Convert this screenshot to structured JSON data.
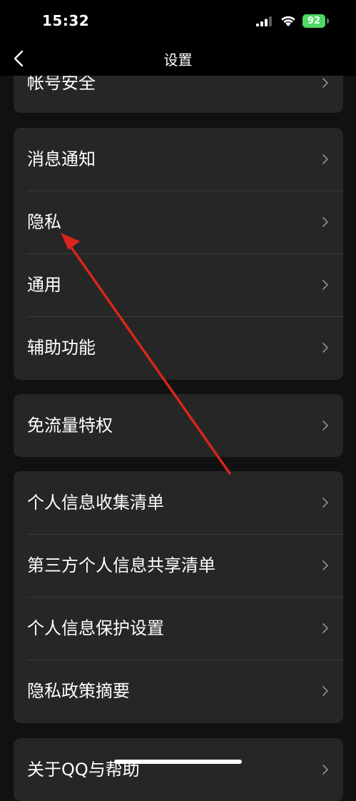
{
  "status_bar": {
    "time": "15:32",
    "battery": "92"
  },
  "nav": {
    "title": "设置"
  },
  "groups": [
    {
      "items": [
        {
          "label": "帐号安全"
        }
      ]
    },
    {
      "items": [
        {
          "label": "消息通知"
        },
        {
          "label": "隐私"
        },
        {
          "label": "通用"
        },
        {
          "label": "辅助功能"
        }
      ]
    },
    {
      "items": [
        {
          "label": "免流量特权"
        }
      ]
    },
    {
      "items": [
        {
          "label": "个人信息收集清单"
        },
        {
          "label": "第三方个人信息共享清单"
        },
        {
          "label": "个人信息保护设置"
        },
        {
          "label": "隐私政策摘要"
        }
      ]
    },
    {
      "items": [
        {
          "label": "关于QQ与帮助"
        }
      ]
    }
  ],
  "icons": {
    "back": "chevron-left-icon",
    "row_chevron": "chevron-right-icon",
    "signal": "cellular-signal-icon",
    "wifi": "wifi-icon",
    "battery": "battery-icon"
  },
  "colors": {
    "background": "#111111",
    "bar_background": "#000000",
    "group_background": "#262626",
    "divider": "#3a3a3a",
    "chevron": "#8a8a8a",
    "battery": "#4cd964",
    "annotation_arrow": "#d9251c"
  }
}
